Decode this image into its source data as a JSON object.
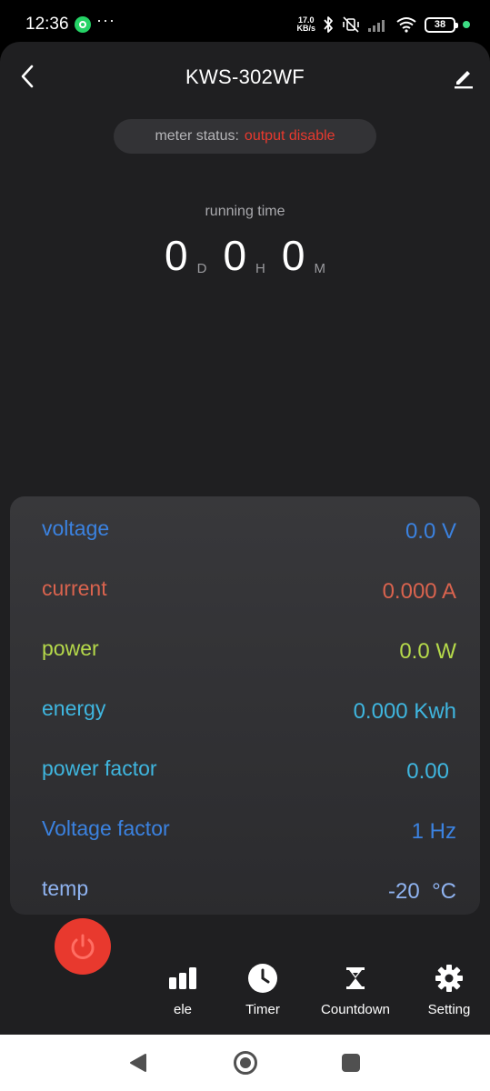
{
  "status_bar": {
    "time": "12:36",
    "more": "···",
    "net_speed": "17.0",
    "net_unit": "KB/s",
    "battery": "38"
  },
  "header": {
    "title": "KWS-302WF"
  },
  "meter_status": {
    "label": "meter status:",
    "value": "output disable"
  },
  "running_time": {
    "label": "running time",
    "days": "0",
    "days_unit": "D",
    "hours": "0",
    "hours_unit": "H",
    "minutes": "0",
    "minutes_unit": "M"
  },
  "readings": [
    {
      "label": "voltage",
      "value": "0.0 V",
      "color": "#3b82e0"
    },
    {
      "label": "current",
      "value": "0.000 A",
      "color": "#d9634e"
    },
    {
      "label": "power",
      "value": "0.0 W",
      "color": "#b5d94a"
    },
    {
      "label": "energy",
      "value": "0.000 Kwh",
      "color": "#3fb6df"
    },
    {
      "label": "power factor",
      "value": "0.00",
      "color": "#3fb6df"
    },
    {
      "label": "Voltage factor",
      "value": "1 Hz",
      "color": "#3b82e0"
    },
    {
      "label": "temp",
      "value": "-20  °C",
      "color": "#8fb3f0"
    }
  ],
  "bottom_tabs": {
    "ele": "ele",
    "timer": "Timer",
    "countdown": "Countdown",
    "setting": "Setting"
  },
  "colors": {
    "accent_red": "#e8392e",
    "background": "#1f1f21"
  }
}
